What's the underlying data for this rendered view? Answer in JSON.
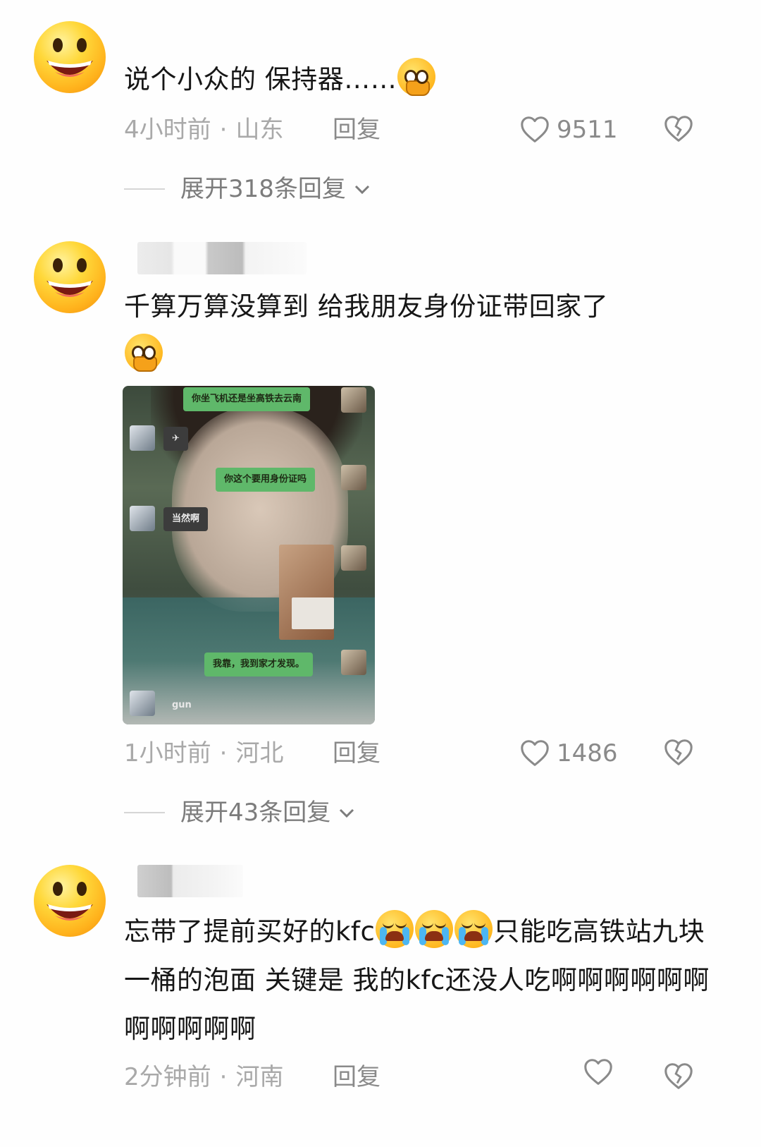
{
  "comments": [
    {
      "text": "说个小众的 保持器……",
      "emoji": "pleading-crying-face",
      "time": "4小时前",
      "location": "山东",
      "reply": "回复",
      "likes": "9511",
      "expand": "展开318条回复"
    },
    {
      "text": "千算万算没算到 给我朋友身份证带回家了",
      "emoji": "pleading-crying-face",
      "time": "1小时前",
      "location": "河北",
      "reply": "回复",
      "likes": "1486",
      "expand": "展开43条回复",
      "image": {
        "messages": [
          {
            "from": "me",
            "text": "你坐飞机还是坐高铁去云南"
          },
          {
            "from": "other",
            "text": "✈"
          },
          {
            "from": "me",
            "text": "你这个要用身份证吗"
          },
          {
            "from": "other",
            "text": "当然啊"
          },
          {
            "from": "me",
            "text": "我靠，我到家才发现。"
          },
          {
            "from": "other",
            "text": "gun"
          }
        ]
      }
    },
    {
      "text_part1": "忘带了提前买好的kfc",
      "text_part2": "只能吃高铁站九块一桶的泡面 关键是 我的kfc还没人吃啊啊啊啊啊啊啊啊啊啊啊",
      "emoji": "loudly-crying-face",
      "time": "2分钟前",
      "location": "河南",
      "reply": "回复",
      "likes": ""
    }
  ],
  "colors": {
    "meta": "#a9a9a9",
    "text": "#161616",
    "bubble_me": "#5fb86a"
  }
}
